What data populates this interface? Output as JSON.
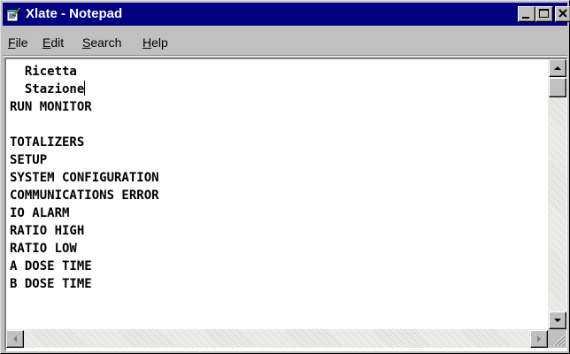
{
  "window": {
    "title": "Xlate - Notepad",
    "title_bar_color": "#000080",
    "title_text_color": "#ffffff",
    "face_color": "#c0c0c0"
  },
  "menu": [
    {
      "label": "File",
      "accel": "F",
      "rest": "ile"
    },
    {
      "label": "Edit",
      "accel": "E",
      "rest": "dit"
    },
    {
      "label": "Search",
      "accel": "S",
      "rest": "earch"
    },
    {
      "label": "Help",
      "accel": "H",
      "rest": "elp"
    }
  ],
  "document": {
    "lines": [
      "  Ricetta",
      "  Stazione",
      "RUN MONITOR",
      "",
      "TOTALIZERS",
      "SETUP",
      "SYSTEM CONFIGURATION",
      "COMMUNICATIONS ERROR",
      "IO ALARM",
      "RATIO HIGH",
      "RATIO LOW",
      "A DOSE TIME",
      "B DOSE TIME"
    ],
    "caret_line": 1
  },
  "icons": {
    "app": "notepad-icon",
    "minimize": "minimize-icon",
    "maximize": "maximize-icon",
    "close": "close-icon",
    "scroll_up": "arrow-up-icon",
    "scroll_down": "arrow-down-icon",
    "scroll_left": "arrow-left-icon",
    "scroll_right": "arrow-right-icon",
    "resize": "resize-grip-icon"
  }
}
